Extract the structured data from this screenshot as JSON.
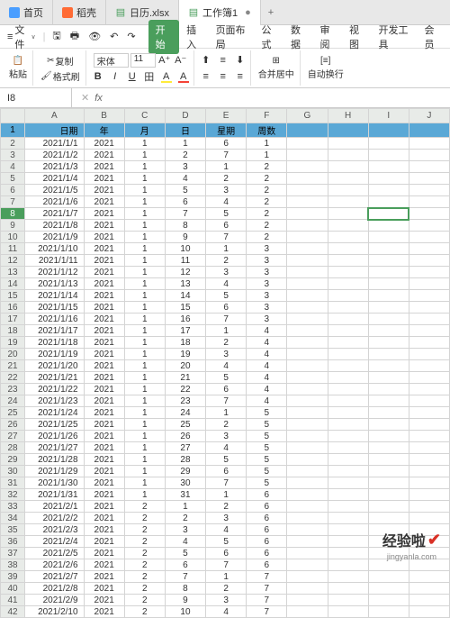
{
  "tabs": [
    {
      "label": "首页",
      "icon": "home",
      "color": "#4a9eff"
    },
    {
      "label": "稻壳",
      "icon": "doc",
      "color": "#ff6b35"
    },
    {
      "label": "日历.xlsx",
      "icon": "xls",
      "color": "#4a9e5c"
    },
    {
      "label": "工作簿1",
      "icon": "xls",
      "color": "#4a9e5c",
      "active": true
    }
  ],
  "menu": {
    "file": "文件",
    "ribbon": [
      "开始",
      "插入",
      "页面布局",
      "公式",
      "数据",
      "审阅",
      "视图",
      "开发工具",
      "会员"
    ]
  },
  "toolbar": {
    "paste": "粘贴",
    "copy": "复制",
    "format_painter": "格式刷",
    "font_name": "宋体",
    "font_size": "11",
    "bold": "B",
    "italic": "I",
    "underline": "U",
    "merge": "合并居中",
    "wrap": "自动换行"
  },
  "namebox": {
    "ref": "I8",
    "fx": "fx"
  },
  "columns": [
    "A",
    "B",
    "C",
    "D",
    "E",
    "F",
    "G",
    "H",
    "I",
    "J"
  ],
  "headers": [
    "日期",
    "年",
    "月",
    "日",
    "星期",
    "周数"
  ],
  "rows": [
    [
      "2021/1/1",
      "2021",
      "1",
      "1",
      "6",
      "1"
    ],
    [
      "2021/1/2",
      "2021",
      "1",
      "2",
      "7",
      "1"
    ],
    [
      "2021/1/3",
      "2021",
      "1",
      "3",
      "1",
      "2"
    ],
    [
      "2021/1/4",
      "2021",
      "1",
      "4",
      "2",
      "2"
    ],
    [
      "2021/1/5",
      "2021",
      "1",
      "5",
      "3",
      "2"
    ],
    [
      "2021/1/6",
      "2021",
      "1",
      "6",
      "4",
      "2"
    ],
    [
      "2021/1/7",
      "2021",
      "1",
      "7",
      "5",
      "2"
    ],
    [
      "2021/1/8",
      "2021",
      "1",
      "8",
      "6",
      "2"
    ],
    [
      "2021/1/9",
      "2021",
      "1",
      "9",
      "7",
      "2"
    ],
    [
      "2021/1/10",
      "2021",
      "1",
      "10",
      "1",
      "3"
    ],
    [
      "2021/1/11",
      "2021",
      "1",
      "11",
      "2",
      "3"
    ],
    [
      "2021/1/12",
      "2021",
      "1",
      "12",
      "3",
      "3"
    ],
    [
      "2021/1/13",
      "2021",
      "1",
      "13",
      "4",
      "3"
    ],
    [
      "2021/1/14",
      "2021",
      "1",
      "14",
      "5",
      "3"
    ],
    [
      "2021/1/15",
      "2021",
      "1",
      "15",
      "6",
      "3"
    ],
    [
      "2021/1/16",
      "2021",
      "1",
      "16",
      "7",
      "3"
    ],
    [
      "2021/1/17",
      "2021",
      "1",
      "17",
      "1",
      "4"
    ],
    [
      "2021/1/18",
      "2021",
      "1",
      "18",
      "2",
      "4"
    ],
    [
      "2021/1/19",
      "2021",
      "1",
      "19",
      "3",
      "4"
    ],
    [
      "2021/1/20",
      "2021",
      "1",
      "20",
      "4",
      "4"
    ],
    [
      "2021/1/21",
      "2021",
      "1",
      "21",
      "5",
      "4"
    ],
    [
      "2021/1/22",
      "2021",
      "1",
      "22",
      "6",
      "4"
    ],
    [
      "2021/1/23",
      "2021",
      "1",
      "23",
      "7",
      "4"
    ],
    [
      "2021/1/24",
      "2021",
      "1",
      "24",
      "1",
      "5"
    ],
    [
      "2021/1/25",
      "2021",
      "1",
      "25",
      "2",
      "5"
    ],
    [
      "2021/1/26",
      "2021",
      "1",
      "26",
      "3",
      "5"
    ],
    [
      "2021/1/27",
      "2021",
      "1",
      "27",
      "4",
      "5"
    ],
    [
      "2021/1/28",
      "2021",
      "1",
      "28",
      "5",
      "5"
    ],
    [
      "2021/1/29",
      "2021",
      "1",
      "29",
      "6",
      "5"
    ],
    [
      "2021/1/30",
      "2021",
      "1",
      "30",
      "7",
      "5"
    ],
    [
      "2021/1/31",
      "2021",
      "1",
      "31",
      "1",
      "6"
    ],
    [
      "2021/2/1",
      "2021",
      "2",
      "1",
      "2",
      "6"
    ],
    [
      "2021/2/2",
      "2021",
      "2",
      "2",
      "3",
      "6"
    ],
    [
      "2021/2/3",
      "2021",
      "2",
      "3",
      "4",
      "6"
    ],
    [
      "2021/2/4",
      "2021",
      "2",
      "4",
      "5",
      "6"
    ],
    [
      "2021/2/5",
      "2021",
      "2",
      "5",
      "6",
      "6"
    ],
    [
      "2021/2/6",
      "2021",
      "2",
      "6",
      "7",
      "6"
    ],
    [
      "2021/2/7",
      "2021",
      "2",
      "7",
      "1",
      "7"
    ],
    [
      "2021/2/8",
      "2021",
      "2",
      "8",
      "2",
      "7"
    ],
    [
      "2021/2/9",
      "2021",
      "2",
      "9",
      "3",
      "7"
    ],
    [
      "2021/2/10",
      "2021",
      "2",
      "10",
      "4",
      "7"
    ]
  ],
  "selected": {
    "row": 8,
    "col": "I"
  },
  "watermark": {
    "main": "经验啦",
    "sub": "jingyanla.com"
  }
}
